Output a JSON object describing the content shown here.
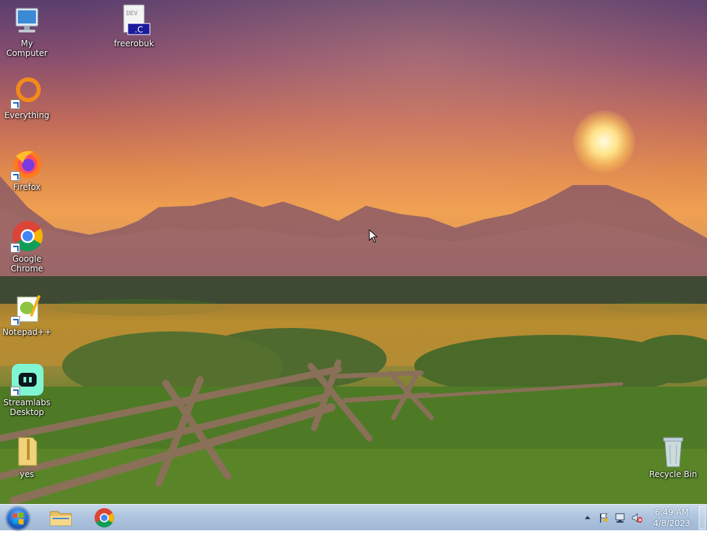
{
  "desktop": {
    "icons": [
      {
        "label": "My Computer",
        "icon": "computer-icon"
      },
      {
        "label": "freerobuk",
        "icon": "c-source-file-icon",
        "badge": "DEV .C"
      },
      {
        "label": "Everything",
        "icon": "everything-icon"
      },
      {
        "label": "Firefox",
        "icon": "firefox-icon"
      },
      {
        "label": "Google Chrome",
        "icon": "chrome-icon"
      },
      {
        "label": "Notepad++",
        "icon": "notepadpp-icon"
      },
      {
        "label": "Streamlabs Desktop",
        "icon": "streamlabs-icon"
      },
      {
        "label": "yes",
        "icon": "zip-folder-icon"
      },
      {
        "label": "Recycle Bin",
        "icon": "recycle-bin-icon"
      }
    ]
  },
  "taskbar": {
    "start_icon": "windows-start-icon",
    "pinned": [
      {
        "name": "file-explorer",
        "icon": "folder-icon"
      },
      {
        "name": "google-chrome",
        "icon": "chrome-icon"
      }
    ],
    "tray": {
      "icons": [
        "show-hidden-icons-arrow",
        "action-center-flag-icon",
        "network-icon",
        "volume-muted-icon"
      ],
      "time": "6:49 AM",
      "date": "4/8/2023"
    }
  },
  "colors": {
    "taskbar": "#aec4de",
    "accent": "#1d62c4"
  }
}
